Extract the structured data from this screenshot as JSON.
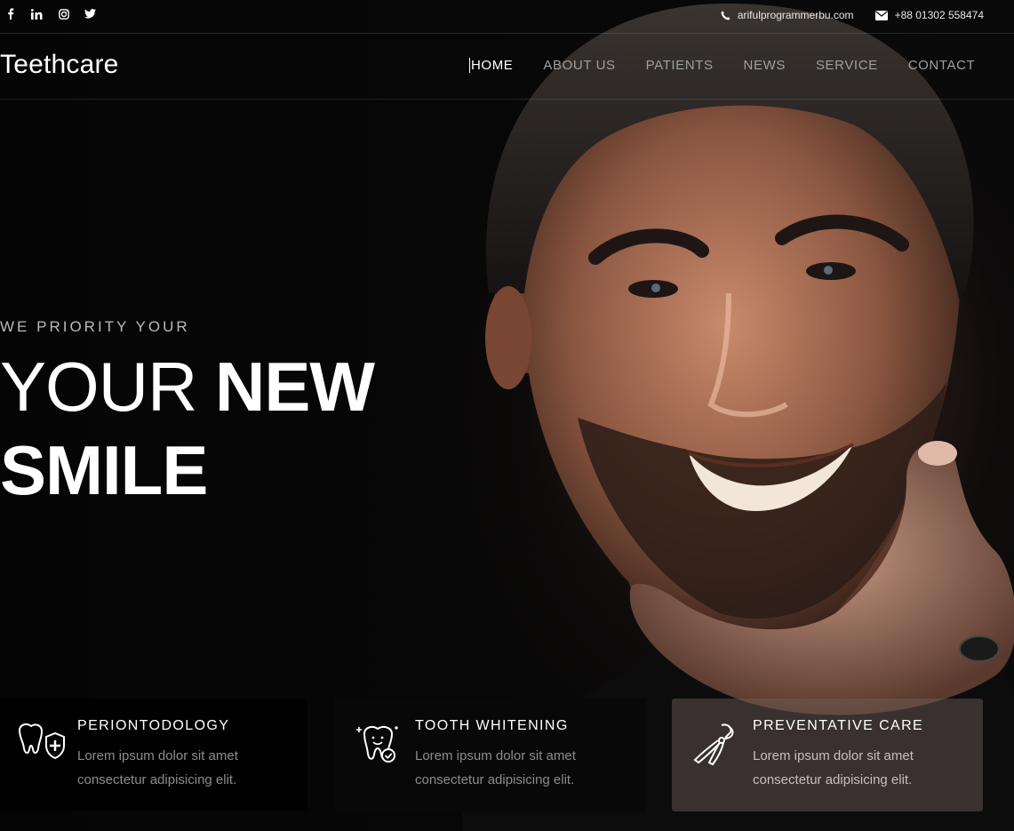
{
  "topbar": {
    "social": [
      {
        "name": "facebook-icon",
        "glyph": "f"
      },
      {
        "name": "linkedin-icon",
        "glyph": "in"
      },
      {
        "name": "instagram-icon",
        "glyph": "◎"
      },
      {
        "name": "twitter-icon",
        "glyph": "🐦"
      }
    ],
    "email": "arifulprogrammerbu.com",
    "phone": "+88 01302 558474"
  },
  "brand": {
    "logo": "Teethcare"
  },
  "nav": {
    "items": [
      {
        "label": "HOME",
        "active": true
      },
      {
        "label": "ABOUT US",
        "active": false
      },
      {
        "label": "PATIENTS",
        "active": false
      },
      {
        "label": "NEWS",
        "active": false
      },
      {
        "label": "SERVICE",
        "active": false
      },
      {
        "label": "CONTACT",
        "active": false
      }
    ]
  },
  "hero": {
    "eyebrow": "WE PRIORITY YOUR",
    "headline_thin": "YOUR ",
    "headline_bold_1": "NEW",
    "headline_bold_2": "SMILE"
  },
  "services": [
    {
      "title": "PERIONTODOLOGY",
      "text": "Lorem ipsum dolor sit amet consectetur adipisicing elit.",
      "icon": "tooth-shield-icon"
    },
    {
      "title": "TOOTH WHITENING",
      "text": "Lorem ipsum dolor sit amet consectetur adipisicing elit.",
      "icon": "sparkling-tooth-icon"
    },
    {
      "title": "PREVENTATIVE CARE",
      "text": "Lorem ipsum dolor sit amet consectetur adipisicing elit.",
      "icon": "dental-pliers-icon"
    }
  ],
  "colors": {
    "background": "#050505",
    "nav_inactive": "#9f9f9f",
    "card_text": "#8c8c8c"
  }
}
